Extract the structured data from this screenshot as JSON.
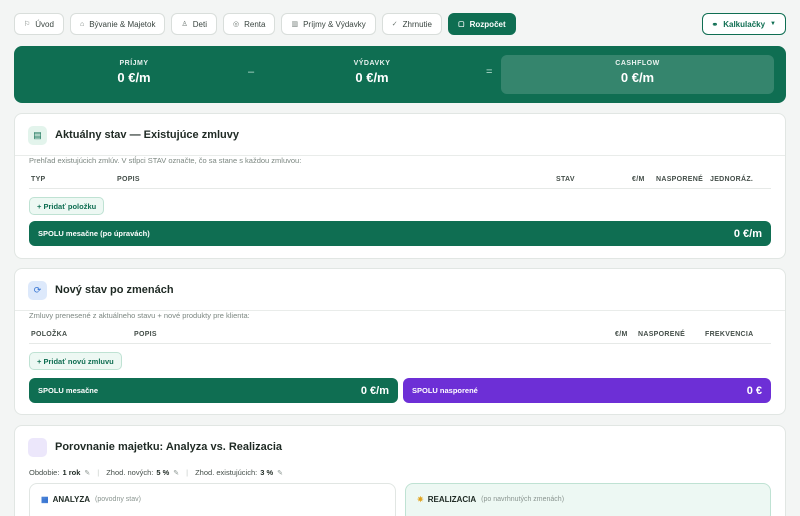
{
  "nav": {
    "tabs": [
      {
        "label": "Úvod",
        "icon": "flag-icon"
      },
      {
        "label": "Bývanie & Majetok",
        "icon": "home-icon"
      },
      {
        "label": "Deti",
        "icon": "child-icon"
      },
      {
        "label": "Renta",
        "icon": "coin-icon"
      },
      {
        "label": "Príjmy & Výdavky",
        "icon": "bar-chart-icon"
      },
      {
        "label": "Zhrnutie",
        "icon": "check-icon"
      },
      {
        "label": "Rozpočet",
        "icon": "wallet-icon",
        "active": true
      }
    ],
    "calculators_label": "Kalkulačky"
  },
  "summary": {
    "income_label": "PRÍJMY",
    "income_value": "0 €/m",
    "minus": "–",
    "expenses_label": "VÝDAVKY",
    "expenses_value": "0 €/m",
    "equals": "=",
    "cashflow_label": "CASHFLOW",
    "cashflow_value": "0 €/m"
  },
  "current": {
    "title": "Aktuálny stav — Existujúce zmluvy",
    "description": "Prehľad existujúcich zmlúv. V stĺpci STAV označte, čo sa stane s každou zmluvou:",
    "columns": [
      "TYP",
      "POPIS",
      "STAV",
      "€/M",
      "NASPORENÉ",
      "JEDNORÁZ."
    ],
    "add_label": "+ Pridať položku",
    "total_label": "SPOLU mesačne (po úpravách)",
    "total_value": "0 €/m"
  },
  "new_state": {
    "title": "Nový stav po zmenách",
    "description": "Zmluvy prenesené z aktuálneho stavu + nové produkty pre klienta:",
    "columns": [
      "POLOŽKA",
      "POPIS",
      "€/M",
      "NASPORENÉ",
      "FREKVENCIA"
    ],
    "add_label": "+ Pridať novú zmluvu",
    "monthly_label": "SPOLU mesačne",
    "monthly_value": "0 €/m",
    "saved_label": "SPOLU nasporené",
    "saved_value": "0 €"
  },
  "comparison": {
    "title": "Porovnanie majetku: Analyza vs. Realizacia",
    "period_label": "Obdobie:",
    "period_value": "1 rok",
    "new_rate_label": "Zhod. nových:",
    "new_rate_value": "5 %",
    "existing_rate_label": "Zhod. existujúcich:",
    "existing_rate_value": "3 %",
    "analysis_title": "ANALYZA",
    "analysis_note": "(povodny stav)",
    "realization_title": "REALIZACIA",
    "realization_note": "(po navrhnutých zmenách)"
  },
  "colors": {
    "accent": "#0f6e52",
    "purple": "#6d2fd6"
  }
}
